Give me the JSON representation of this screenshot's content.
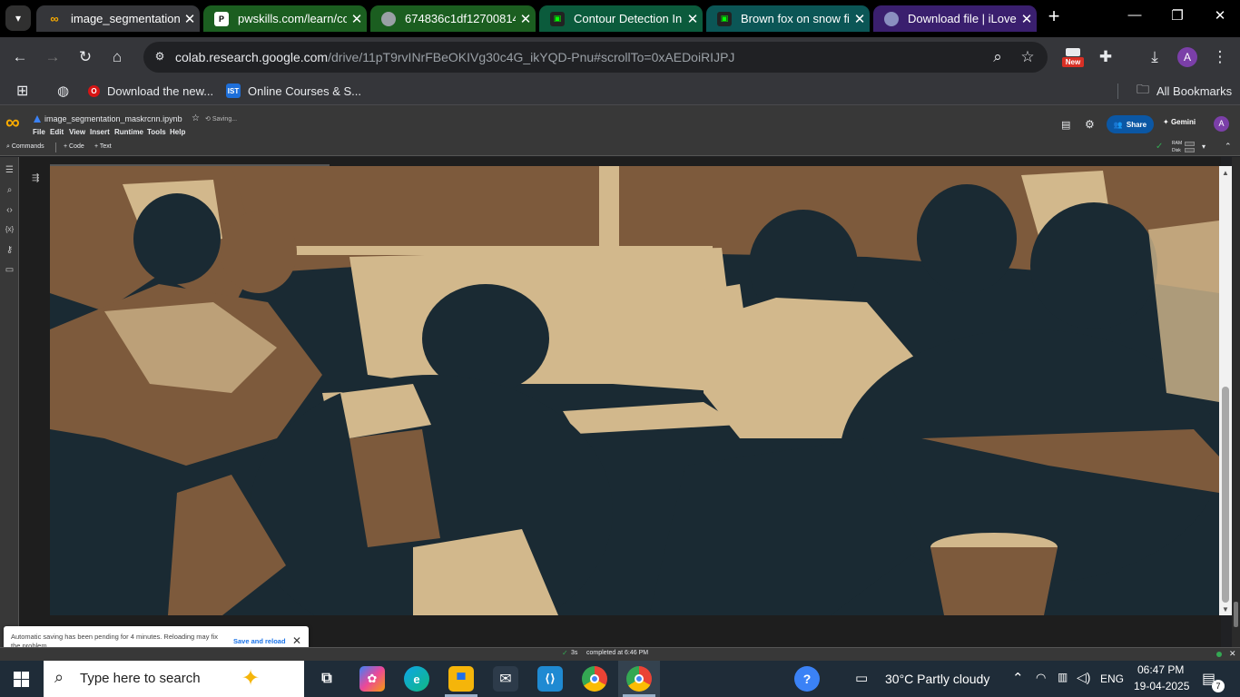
{
  "browser": {
    "tabs": [
      {
        "title": "image_segmentation_",
        "favicon": "colab",
        "active": true
      },
      {
        "title": "pwskills.com/learn/co",
        "favicon": "pw"
      },
      {
        "title": "674836c1df12700814",
        "favicon": "globe"
      },
      {
        "title": "Contour Detection In",
        "favicon": "glitch"
      },
      {
        "title": "Brown fox on snow fi",
        "favicon": "glitch"
      },
      {
        "title": "Download file | iLove",
        "favicon": "ilove"
      }
    ],
    "new_tab_label": "+",
    "url_host": "colab.research.google.com",
    "url_path": "/drive/11pT9rvINrFBeOKIVg30c4G_ikYQD-Pnu#scrollTo=0xAEDoiRIJPJ",
    "new_badge": "New",
    "profile_initial": "A",
    "bookmarks": [
      {
        "label": "Download the new...",
        "icon": "opera"
      },
      {
        "label": "Online Courses & S...",
        "icon": "ist"
      }
    ],
    "all_bookmarks_label": "All Bookmarks"
  },
  "colab": {
    "notebook_name": "image_segmentation_maskrcnn.ipynb",
    "saving_status": "Saving...",
    "menus": [
      "File",
      "Edit",
      "View",
      "Insert",
      "Runtime",
      "Tools",
      "Help"
    ],
    "commands_label": "Commands",
    "code_label": "+ Code",
    "text_label": "+ Text",
    "share_label": "Share",
    "gemini_label": "Gemini",
    "ram_label": "RAM",
    "disk_label": "Disk",
    "status_duration": "3s",
    "status_completed": "completed at 6:46 PM",
    "toast_message": "Automatic saving has been pending for 4 minutes. Reloading may fix the problem.",
    "toast_action": "Save and reload"
  },
  "taskbar": {
    "search_placeholder": "Type here to search",
    "weather": "30°C  Partly cloudy",
    "language": "ENG",
    "time": "06:47 PM",
    "date": "19-04-2025",
    "notification_count": "7"
  },
  "colors": {
    "image_dark": "#1a2a33",
    "image_mid": "#7d5a3c",
    "image_light": "#d2b88c",
    "accent_blue": "#1a73e8"
  }
}
